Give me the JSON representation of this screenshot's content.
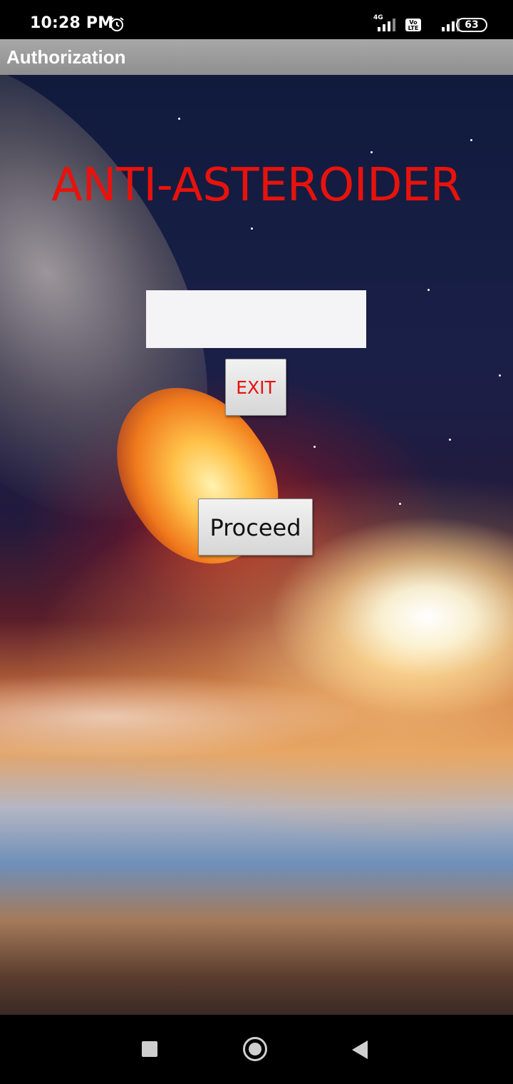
{
  "status_bar": {
    "time": "10:28 PM",
    "alarm_icon": "alarm-clock-icon",
    "network_label": "4G",
    "volte_label": "Vo LTE",
    "battery_level": "63"
  },
  "action_bar": {
    "title": "Authorization"
  },
  "main": {
    "app_title": "ANTI-ASTEROIDER",
    "code_input_value": "",
    "exit_button_label": "EXIT",
    "proceed_button_label": "Proceed"
  },
  "nav_bar": {
    "recents_icon": "square-recents-icon",
    "home_icon": "circle-home-icon",
    "back_icon": "triangle-back-icon"
  },
  "colors": {
    "title_red": "#e8120d",
    "action_bar_gray": "#9a9a9a",
    "input_bg": "#f4f3f5"
  }
}
